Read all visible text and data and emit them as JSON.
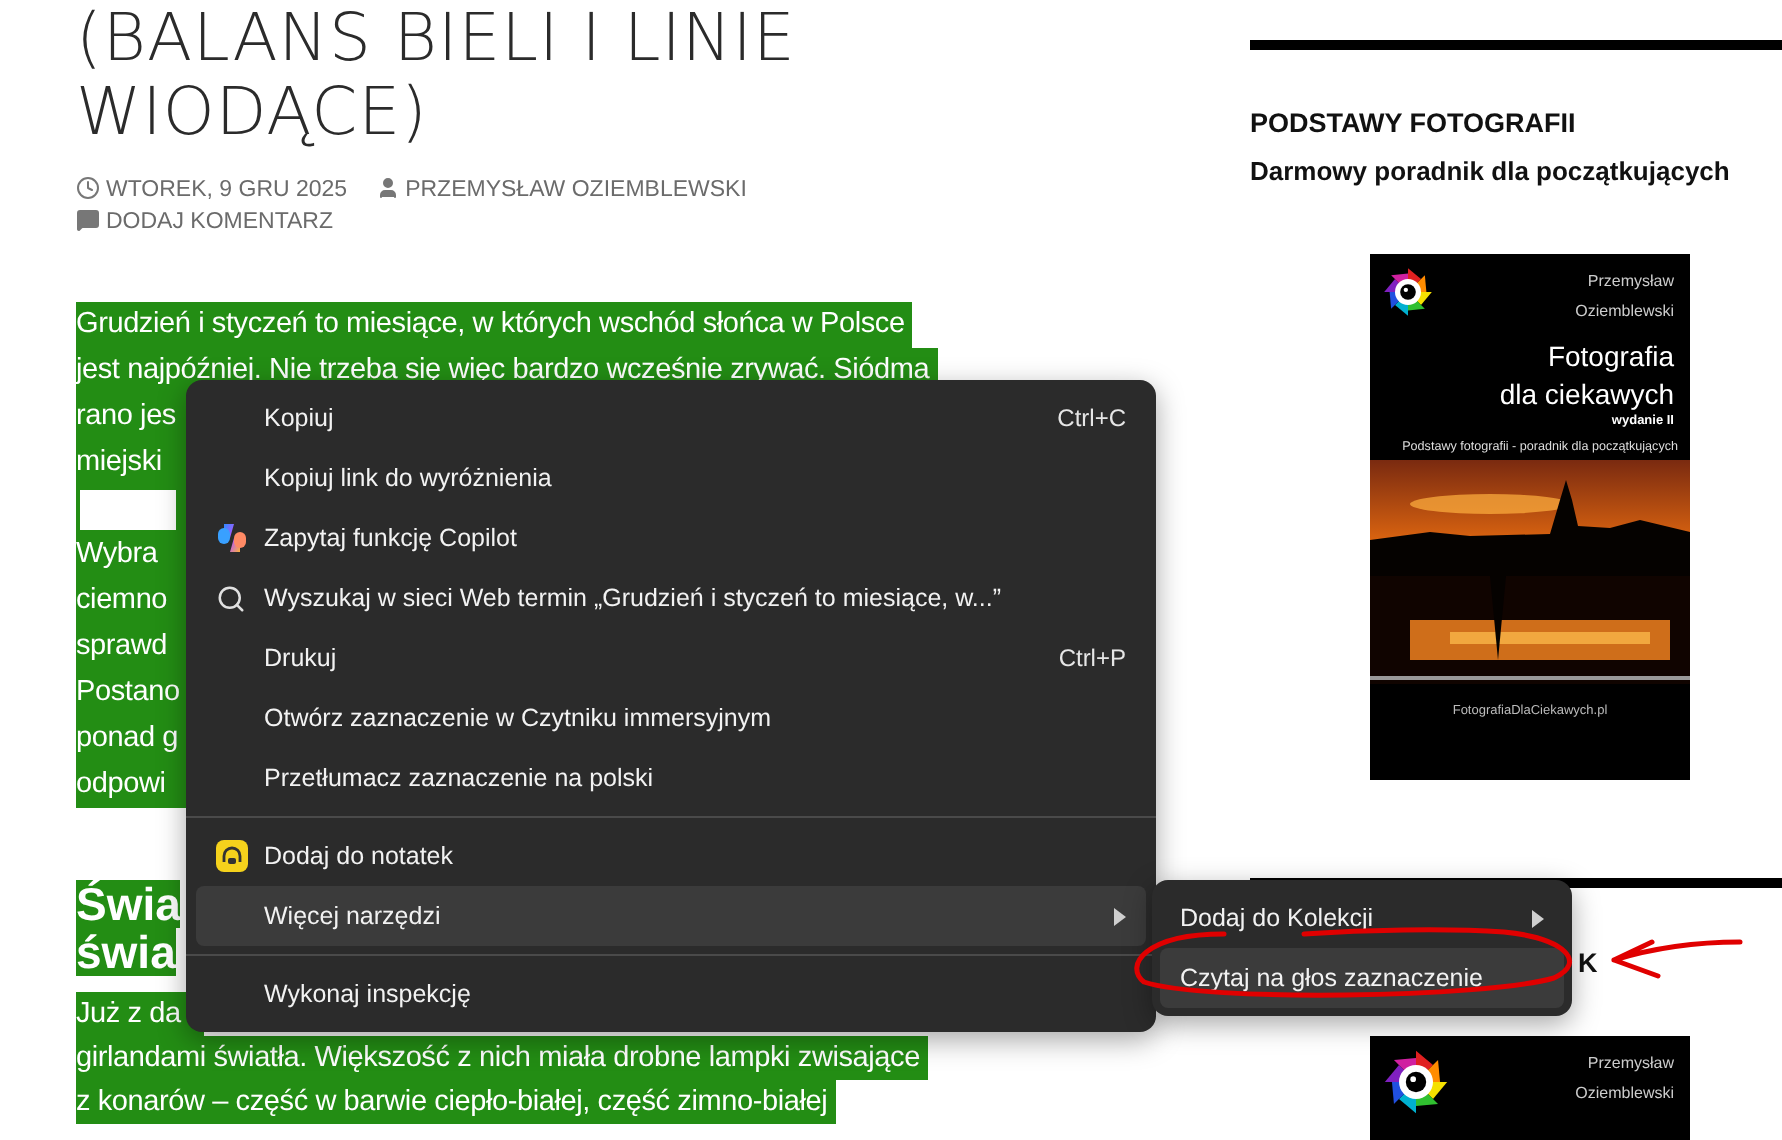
{
  "article": {
    "title_lines": [
      "(BALANS BIELI I LINIE",
      "WIODĄCE)"
    ],
    "meta": [
      {
        "kind": "date",
        "text": "WTOREK, 9 GRU 2025"
      },
      {
        "kind": "author",
        "text": "PRZEMYSŁAW OZIEMBLEWSKI"
      },
      {
        "kind": "comments",
        "text": "DODAJ KOMENTARZ"
      }
    ],
    "paragraph_lines": [
      {
        "kind": "text",
        "text": "Grudzień i styczeń to miesiące, w których wschód słońca w Polsce"
      },
      {
        "kind": "text",
        "text": "jest najpóźniej. Nie trzeba się więc bardzo wcześnie zrywać. Siódma"
      },
      {
        "kind": "text",
        "text": "rano jes"
      },
      {
        "kind": "text",
        "text": "miejski"
      },
      {
        "kind": "blank"
      },
      {
        "kind": "text",
        "text": "Wybra"
      },
      {
        "kind": "text",
        "text": "ciemno"
      },
      {
        "kind": "text",
        "text": "sprawd"
      },
      {
        "kind": "text",
        "text": "Postano"
      },
      {
        "kind": "text",
        "text": "ponad g"
      },
      {
        "kind": "text",
        "text": "odpowi"
      }
    ],
    "heading_lines": [
      "Świa",
      "świa"
    ],
    "paragraph2_lines": [
      "Już z da",
      "girlandami światła. Większość z nich miała drobne lampki zwisające",
      "z konarów – część w barwie ciepło-białej, część zimno-białej"
    ]
  },
  "sidebar": {
    "widget_title": "PODSTAWY FOTOGRAFII",
    "widget_subtitle": "Darmowy poradnik dla początkujących",
    "cover": {
      "author_lines": [
        "Przemysław",
        "Oziemblewski"
      ],
      "title_lines": [
        "Fotografia",
        "dla ciekawych"
      ],
      "edition": "wydanie II",
      "tagline": "Podstawy fotografii - poradnik dla początkujących",
      "url": "FotografiaDlaCiekawych.pl"
    },
    "second_widget_title": "K",
    "second_cover": {
      "author_lines": [
        "Przemysław",
        "Oziemblewski"
      ]
    }
  },
  "context_menu": {
    "items": [
      {
        "kind": "item",
        "label": "Kopiuj",
        "shortcut": "Ctrl+C",
        "selected": false
      },
      {
        "kind": "item",
        "label": "Kopiuj link do wyróżnienia",
        "selected": false
      },
      {
        "kind": "copilot_item",
        "label": "Zapytaj funkcję Copilot",
        "selected": false
      },
      {
        "kind": "search_item",
        "label": "Wyszukaj w sieci Web termin „Grudzień i styczeń to miesiące, w...”",
        "selected": false
      },
      {
        "kind": "item",
        "label": "Drukuj",
        "shortcut": "Ctrl+P",
        "selected": false
      },
      {
        "kind": "item",
        "label": "Otwórz zaznaczenie w Czytniku immersyjnym",
        "selected": false
      },
      {
        "kind": "item",
        "label": "Przetłumacz zaznaczenie na polski",
        "selected": false
      },
      {
        "kind": "separator"
      },
      {
        "kind": "notes_item",
        "label": "Dodaj do notatek",
        "selected": false
      },
      {
        "kind": "submenu_item",
        "label": "Więcej narzędzi",
        "selected": true
      },
      {
        "kind": "separator"
      },
      {
        "kind": "item",
        "label": "Wykonaj inspekcję",
        "selected": false
      }
    ]
  },
  "submenu": {
    "items": [
      {
        "kind": "submenu_item",
        "label": "Dodaj do Kolekcji",
        "selected": false
      },
      {
        "kind": "item",
        "label": "Czytaj na głos zaznaczenie",
        "selected": true
      }
    ]
  }
}
